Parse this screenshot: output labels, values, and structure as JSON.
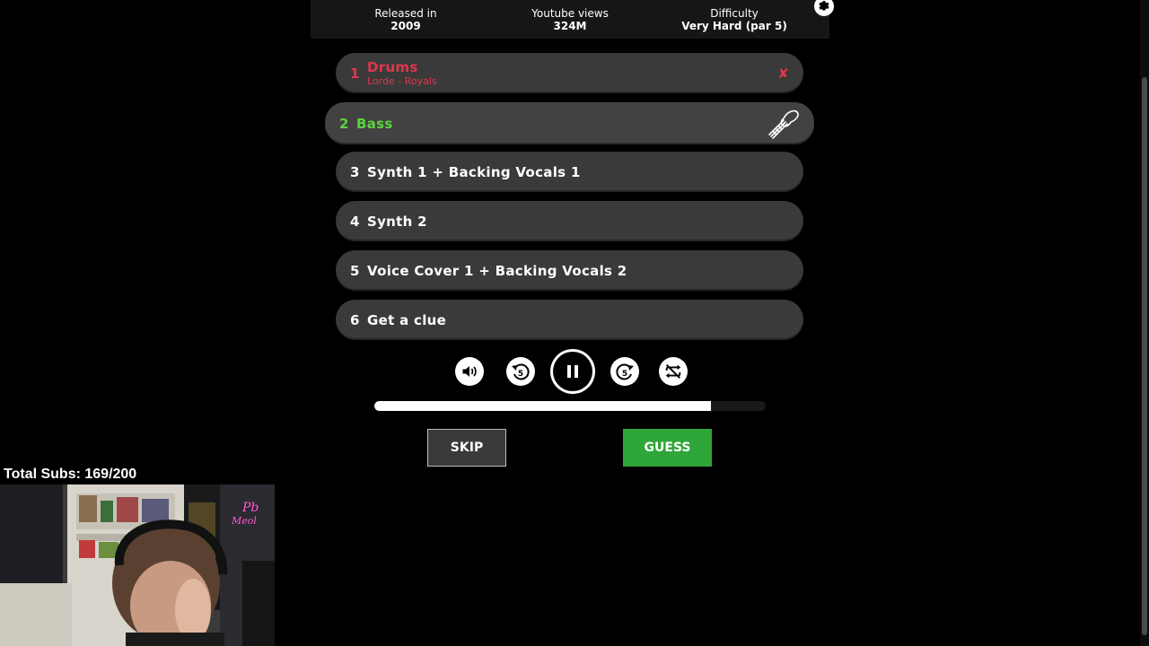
{
  "info": {
    "released_label": "Released in",
    "released_value": "2009",
    "views_label": "Youtube views",
    "views_value": "324M",
    "difficulty_label": "Difficulty",
    "difficulty_value": "Very Hard (par 5)"
  },
  "tracks": [
    {
      "num": "1",
      "name": "Drums",
      "sub": "Lorde - Royals",
      "state": "failed",
      "mark": "✘"
    },
    {
      "num": "2",
      "name": "Bass",
      "state": "active"
    },
    {
      "num": "3",
      "name": "Synth 1 + Backing Vocals 1"
    },
    {
      "num": "4",
      "name": "Synth 2"
    },
    {
      "num": "5",
      "name": "Voice Cover 1 + Backing Vocals 2"
    },
    {
      "num": "6",
      "name": "Get a clue"
    }
  ],
  "controls": {
    "rewind_seconds": "5",
    "forward_seconds": "5"
  },
  "progress": {
    "fraction": 0.86
  },
  "buttons": {
    "skip": "SKIP",
    "guess": "GUESS"
  },
  "overlay": {
    "subs": "Total Subs: 169/200"
  },
  "colors": {
    "fail": "#e0364d",
    "active": "#5cd43d",
    "guess": "#2fa63a"
  }
}
